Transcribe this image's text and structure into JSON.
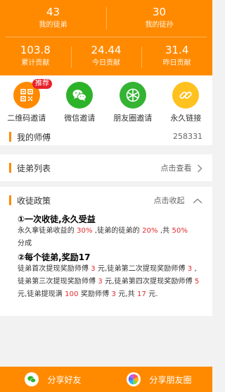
{
  "stats_top": [
    {
      "value": "43",
      "label": "我的徒弟"
    },
    {
      "value": "30",
      "label": "我的徒孙"
    }
  ],
  "stats_bottom": [
    {
      "value": "103.8",
      "label": "累计贡献"
    },
    {
      "value": "24.44",
      "label": "今日贡献"
    },
    {
      "value": "31.4",
      "label": "昨日贡献"
    }
  ],
  "invite": {
    "badge": "推荐",
    "items": [
      {
        "label": "二维码邀请",
        "icon": "qrcode-icon",
        "color": "#ff8a00"
      },
      {
        "label": "微信邀请",
        "icon": "wechat-icon",
        "color": "#2db329"
      },
      {
        "label": "朋友圈邀请",
        "icon": "moments-icon",
        "color": "#35b334"
      },
      {
        "label": "永久链接",
        "icon": "link-icon",
        "color": "#ffc11e"
      }
    ]
  },
  "master": {
    "label": "我的师傅",
    "value": "258331"
  },
  "apprentices": {
    "label": "徒弟列表",
    "action": "点击查看"
  },
  "policy": {
    "label": "收徒政策",
    "action": "点击收起",
    "h1": "①一次收徒,永久受益",
    "p1_a": "永久拿徒弟收益的 ",
    "p1_b": "30%",
    "p1_c": " ,徒弟的徒弟的 ",
    "p1_d": "20%",
    "p1_e": " ,共 ",
    "p1_f": "50%",
    "p1_g": "分成",
    "h2": "②每个徒弟,奖励17",
    "l1_a": "徒弟首次提现奖励师傅 ",
    "l1_b": "3",
    "l1_c": " 元,徒弟第二次提现奖励师傅 ",
    "l1_d": "3",
    "l1_e": " ,",
    "l2_a": "徒弟第三次提现奖励师傅 ",
    "l2_b": "3",
    "l2_c": " 元,徒弟第四次提现奖励师傅 ",
    "l2_d": "5",
    "l3_a": "元,徒弟提现满 ",
    "l3_b": "100",
    "l3_c": " 奖励师傅 ",
    "l3_d": "3",
    "l3_e": " 元,共 ",
    "l3_f": "17",
    "l3_g": " 元."
  },
  "bottom": {
    "share_friend": "分享好友",
    "share_moments": "分享朋友圈"
  },
  "colors": {
    "accent": "#ff8a00",
    "highlight": "#e52b2b"
  }
}
